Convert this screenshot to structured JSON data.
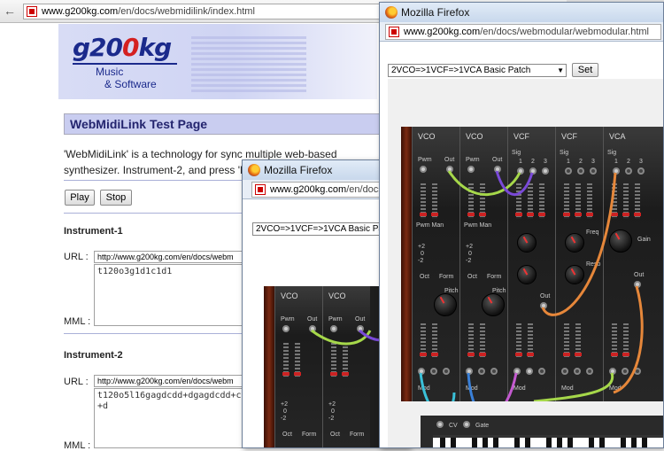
{
  "back_window": {
    "url_site": "www.g200kg.com",
    "url_path": "/en/docs/webmidilink/index.html",
    "logo_text_pre": "g20",
    "logo_text_o": "0",
    "logo_text_post": "kg",
    "logo_sub1": "Music",
    "logo_sub2": "& Software",
    "page_title": "WebMidiLink Test Page",
    "description": "'WebMidiLink' is a technology for sync multiple web-based synthesizer. Instrument-2, and press 'Play'.",
    "play_label": "Play",
    "stop_label": "Stop",
    "instrument1": {
      "heading": "Instrument-1",
      "url_label": "URL :",
      "url_value": "http://www.g200kg.com/en/docs/webm",
      "mml_text": "t120o3g1d1c1d1",
      "mml_label": "MML :"
    },
    "instrument2": {
      "heading": "Instrument-2",
      "url_label": "URL :",
      "url_value": "http://www.g200kg.com/en/docs/webm",
      "mml_text": "t120o5l16gagdcdd+dgagdcdd+c\n+d",
      "mml_label": "MML :"
    }
  },
  "window_front": {
    "title": "Mozilla Firefox",
    "url_site": "www.g200kg.com",
    "url_path": "/en/docs/webmodular/webmodular.html",
    "patch_select": "2VCO=>1VCF=>1VCA Basic Patch",
    "set_label": "Set"
  },
  "window_middle": {
    "title": "Mozilla Firefox",
    "url_site": "www.g200kg.com",
    "url_path": "/en/docs",
    "patch_select": "2VCO=>1VCF=>1VCA Basic Patc"
  },
  "modules": {
    "vco": "VCO",
    "vcf": "VCF",
    "vca": "VCA",
    "pwm": "Pwm",
    "out": "Out",
    "sig": "Sig",
    "pwm_man": "Pwm Man",
    "freq": "Freq",
    "reso": "Reso",
    "gain": "Gain",
    "oct": "Oct",
    "form": "Form",
    "pitch": "Pitch",
    "mod": "Mod",
    "cv": "CV",
    "gate": "Gate",
    "n1": "1",
    "n2": "2",
    "n3": "3",
    "p2": "+2",
    "z0": "0",
    "m2": "-2"
  },
  "cable_colors": [
    "#a6d84a",
    "#7a4ad8",
    "#e6873a",
    "#3ac0d8",
    "#c45ad0"
  ]
}
